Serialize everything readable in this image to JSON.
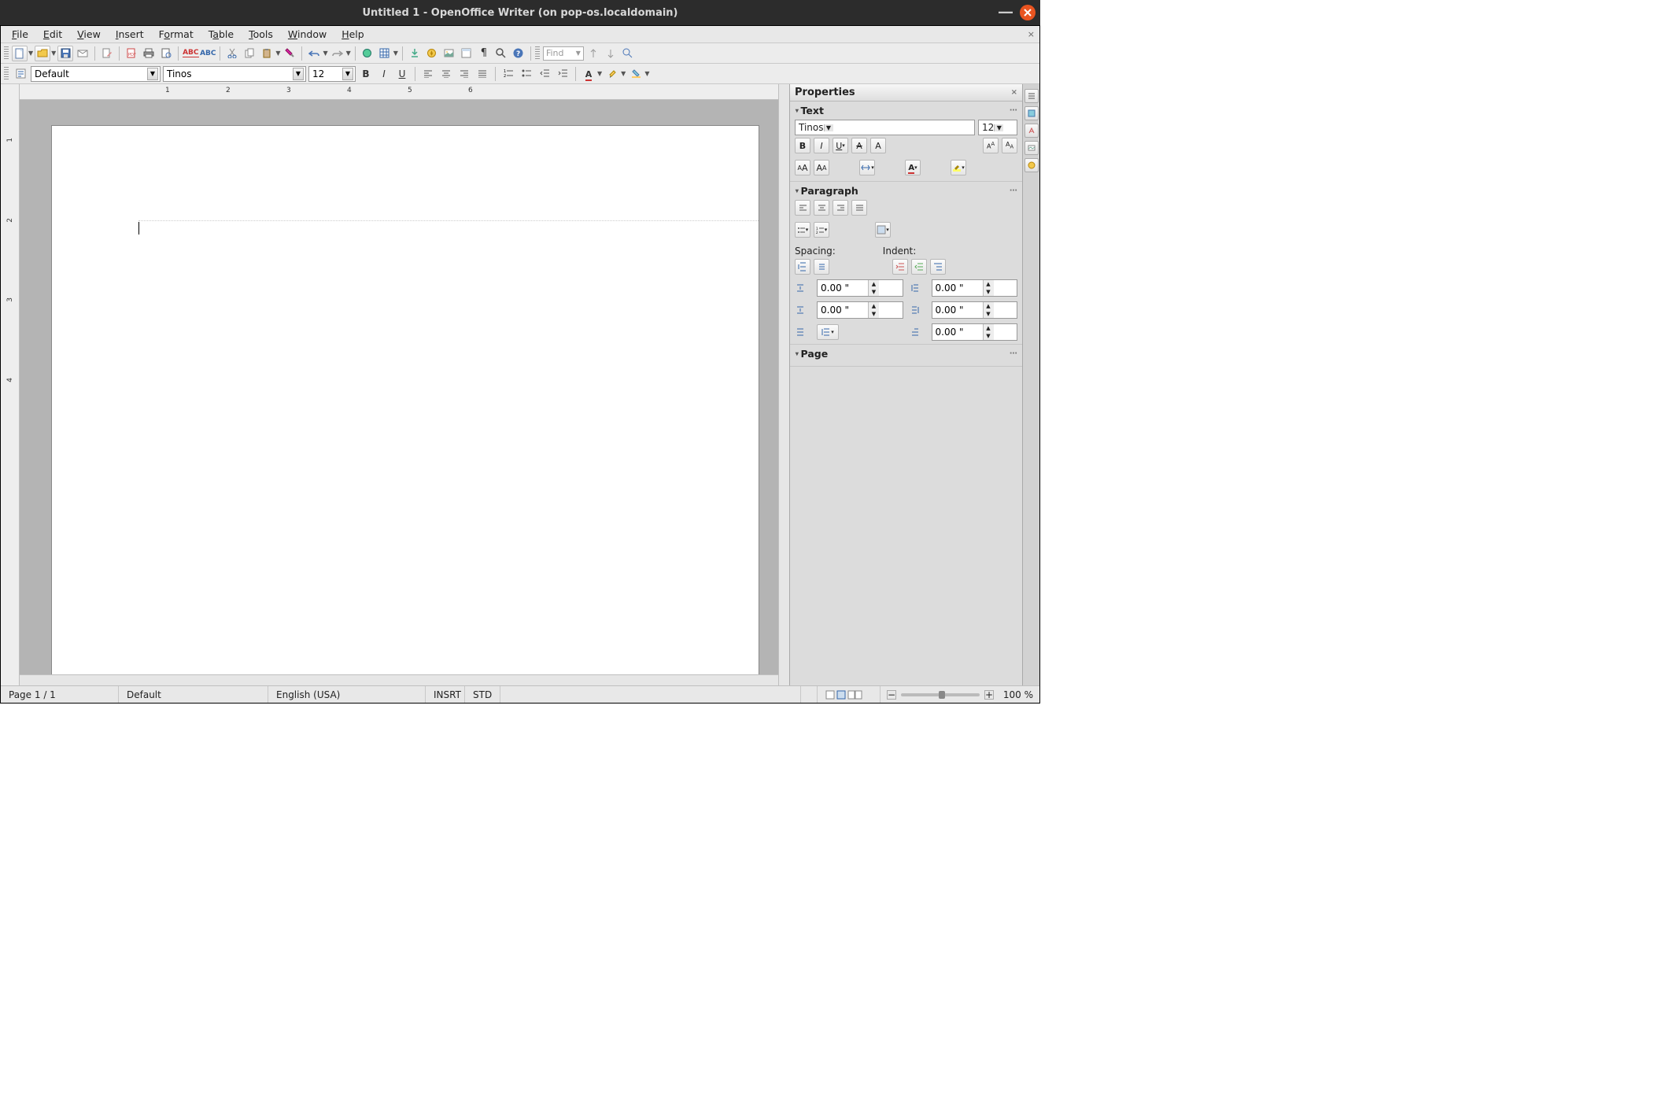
{
  "window": {
    "title": "Untitled 1 - OpenOffice Writer (on pop-os.localdomain)"
  },
  "menu": {
    "file": "File",
    "edit": "Edit",
    "view": "View",
    "insert": "Insert",
    "format": "Format",
    "table": "Table",
    "tools": "Tools",
    "window": "Window",
    "help": "Help"
  },
  "toolbar": {
    "find_placeholder": "Find"
  },
  "formatting": {
    "style": "Default",
    "font": "Tinos",
    "size": "12"
  },
  "ruler": {
    "marks": [
      "1",
      "2",
      "3",
      "4",
      "5",
      "6"
    ]
  },
  "sidebar": {
    "title": "Properties",
    "text": {
      "label": "Text",
      "font": "Tinos",
      "size": "12"
    },
    "paragraph": {
      "label": "Paragraph",
      "spacing_label": "Spacing:",
      "indent_label": "Indent:",
      "above": "0.00 \"",
      "below": "0.00 \"",
      "left": "0.00 \"",
      "right": "0.00 \"",
      "firstline": "0.00 \""
    },
    "page": {
      "label": "Page"
    }
  },
  "status": {
    "page": "Page 1 / 1",
    "style": "Default",
    "language": "English (USA)",
    "insert": "INSRT",
    "selmode": "STD",
    "zoom": "100 %"
  }
}
